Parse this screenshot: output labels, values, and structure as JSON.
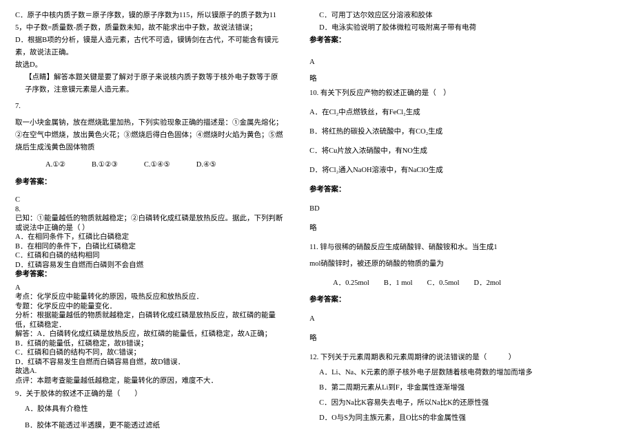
{
  "left": {
    "p1": "C．原子中核内质子数＝原子序数，镆的原子序数为115，所以镆原子的质子数为115，中子数=质量数-质子数，质量数未知，故不能求出中子数，故说法错误；",
    "p2": "D．根据B项的分析，镆是人造元素，古代不可造，镆铸剑在古代，不可能含有镆元素，故说法正确。",
    "p3": "故选D。",
    "p4": "【点睛】解答本题关键是要了解对于原子来说核内质子数等于核外电子数等于原子序数，注意镆元素是人造元素。",
    "q7num": "7.",
    "q7body": "取一小块金属钠，放在燃烧匙里加热，下列实验现象正确的描述是：①金属先熔化；②在空气中燃烧，放出黄色火花；③燃烧后得白色固体；④燃烧时火焰为黄色；⑤燃烧后生成浅黄色固体物质",
    "q7A": "A.①②",
    "q7B": "B.①②③",
    "q7C": "C.①④⑤",
    "q7D": "D.④⑤",
    "ansLabel7": "参考答案：",
    "ans7": "C",
    "q8num": "8.",
    "q8body": "已知：①能量越低的物质就越稳定；②白磷转化成红磷是放热反应。据此，下列判断或说法中正确的是（ ）",
    "q8A": "A．在相同条件下，红磷比白磷稳定",
    "q8B": "B．在相同的条件下，白磷比红磷稳定",
    "q8C": "C．红磷和白磷的结构相同",
    "q8D": "D．红磷容易发生自燃而白磷则不会自燃",
    "ansLabel8": "参考答案：",
    "ans8": "A",
    "exKaodian": "考点：化学反应中能量转化的原因，吸热反应和放热反应．",
    "exZhuanti": "专题：化学反应中的能量变化．",
    "exFenxi": "分析：根据能量越低的物质就越稳定，白磷转化成红磷是放热反应，故红磷的能量低，红磷稳定．",
    "exA": "解答：A．白磷转化成红磷是放热反应，故红磷的能量低，红磷稳定，故A正确；",
    "exB": "B．红磷的能量低，红磷稳定，故B错误；",
    "exC": "C．红磷和白磷的结构不同，故C错误；",
    "exD": "D．红磷不容易发生自燃而白磷容易自燃，故D错误．",
    "exSel": "故选A.",
    "exComment": "点评：本题考查能量越低越稳定，能量转化的原因，难度不大．",
    "q9": "9．关于胶体的叙述不正确的是（　　）",
    "q9A": "A．胶体具有介稳性",
    "q9B": "B．胶体不能透过半透膜，更不能透过滤纸"
  },
  "right": {
    "q9C": "C．可用丁达尔效应区分溶液和胶体",
    "q9D": "D．电泳实验说明了胶体微粒可吸附离子带有电荷",
    "ansLabel9": "参考答案：",
    "ans9": "A",
    "ans9note": "略",
    "q10": "10. 有关下列反应产物的叙述正确的是（　）",
    "q10A": "A．在Cl₂中点燃铁丝，有FeCl₂生成",
    "q10B": "B．将红热的碳投入浓硫酸中，有CO₂生成",
    "q10C": "C．将Cu片放入浓硝酸中，有NO生成",
    "q10D": "D．将Cl₂通入NaOH溶液中，有NaClO生成",
    "ansLabel10": "参考答案：",
    "ans10": "BD",
    "ans10note": "略",
    "q11a": "11. 锌与很稀的硝酸反应生成硝酸锌、硝酸铵和水。当生成1",
    "q11b": "mol硝酸锌时，被还原的硝酸的物质的量为",
    "q11opts": "A．0.25mol　　B．1 mol　　C．0.5mol　　D．2mol",
    "ansLabel11": "参考答案：",
    "ans11": "A",
    "ans11note": "略",
    "q12": "12. 下列关于元素周期表和元素周期律的说法错误的是（　　　）",
    "q12A": "A．Li、Na、K元素的原子核外电子层数随着核电荷数的增加而增多",
    "q12B": "B．第二周期元素从Li到F，非金属性逐渐增强",
    "q12C": "C．因为Na比K容易失去电子，所以Na比K的还原性强",
    "q12D": "D．O与S为同主族元素，且O比S的非金属性强"
  }
}
